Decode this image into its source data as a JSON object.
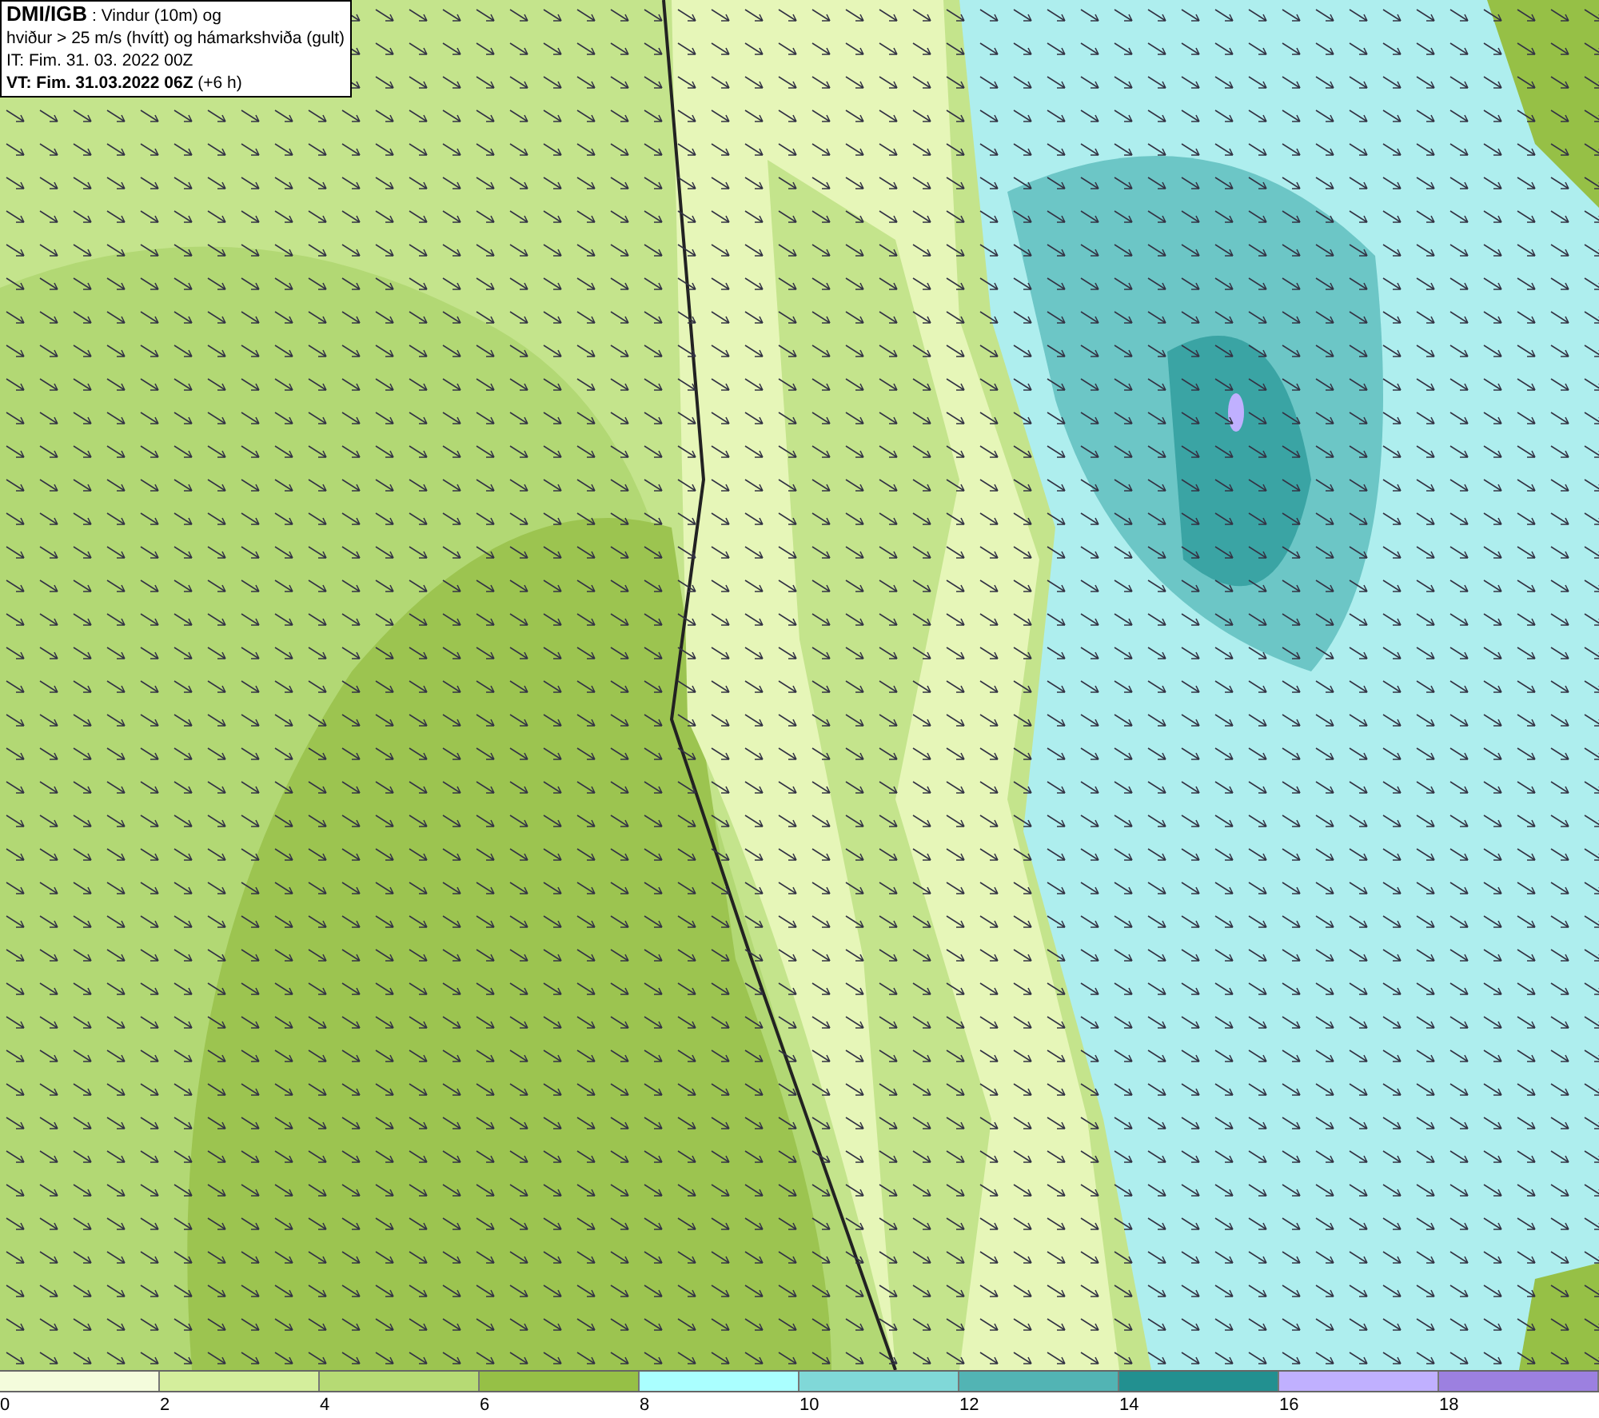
{
  "info_box": {
    "lines": [
      "**DMI/IGB** : Vindur (10m) og",
      "hviður > 25 m/s (hvítt) og hámarkshviða (gult)",
      "IT: Fim. 31. 03. 2022 00Z",
      "**VT: Fim. 31.03.2022 06Z** (+6 h)"
    ]
  },
  "legend": {
    "bins": [
      {
        "color": "#f4fcdc"
      },
      {
        "color": "#d4ee9c"
      },
      {
        "color": "#b6da74"
      },
      {
        "color": "#96c046"
      },
      {
        "color": "#aaffff"
      },
      {
        "color": "#80d8d8"
      },
      {
        "color": "#52b4b4"
      },
      {
        "color": "#229090"
      },
      {
        "color": "#c0b0ff"
      },
      {
        "color": "#9c80e0"
      }
    ],
    "ticks": [
      "0",
      "2",
      "4",
      "6",
      "8",
      "10",
      "12",
      "14",
      "16",
      "18"
    ]
  }
}
